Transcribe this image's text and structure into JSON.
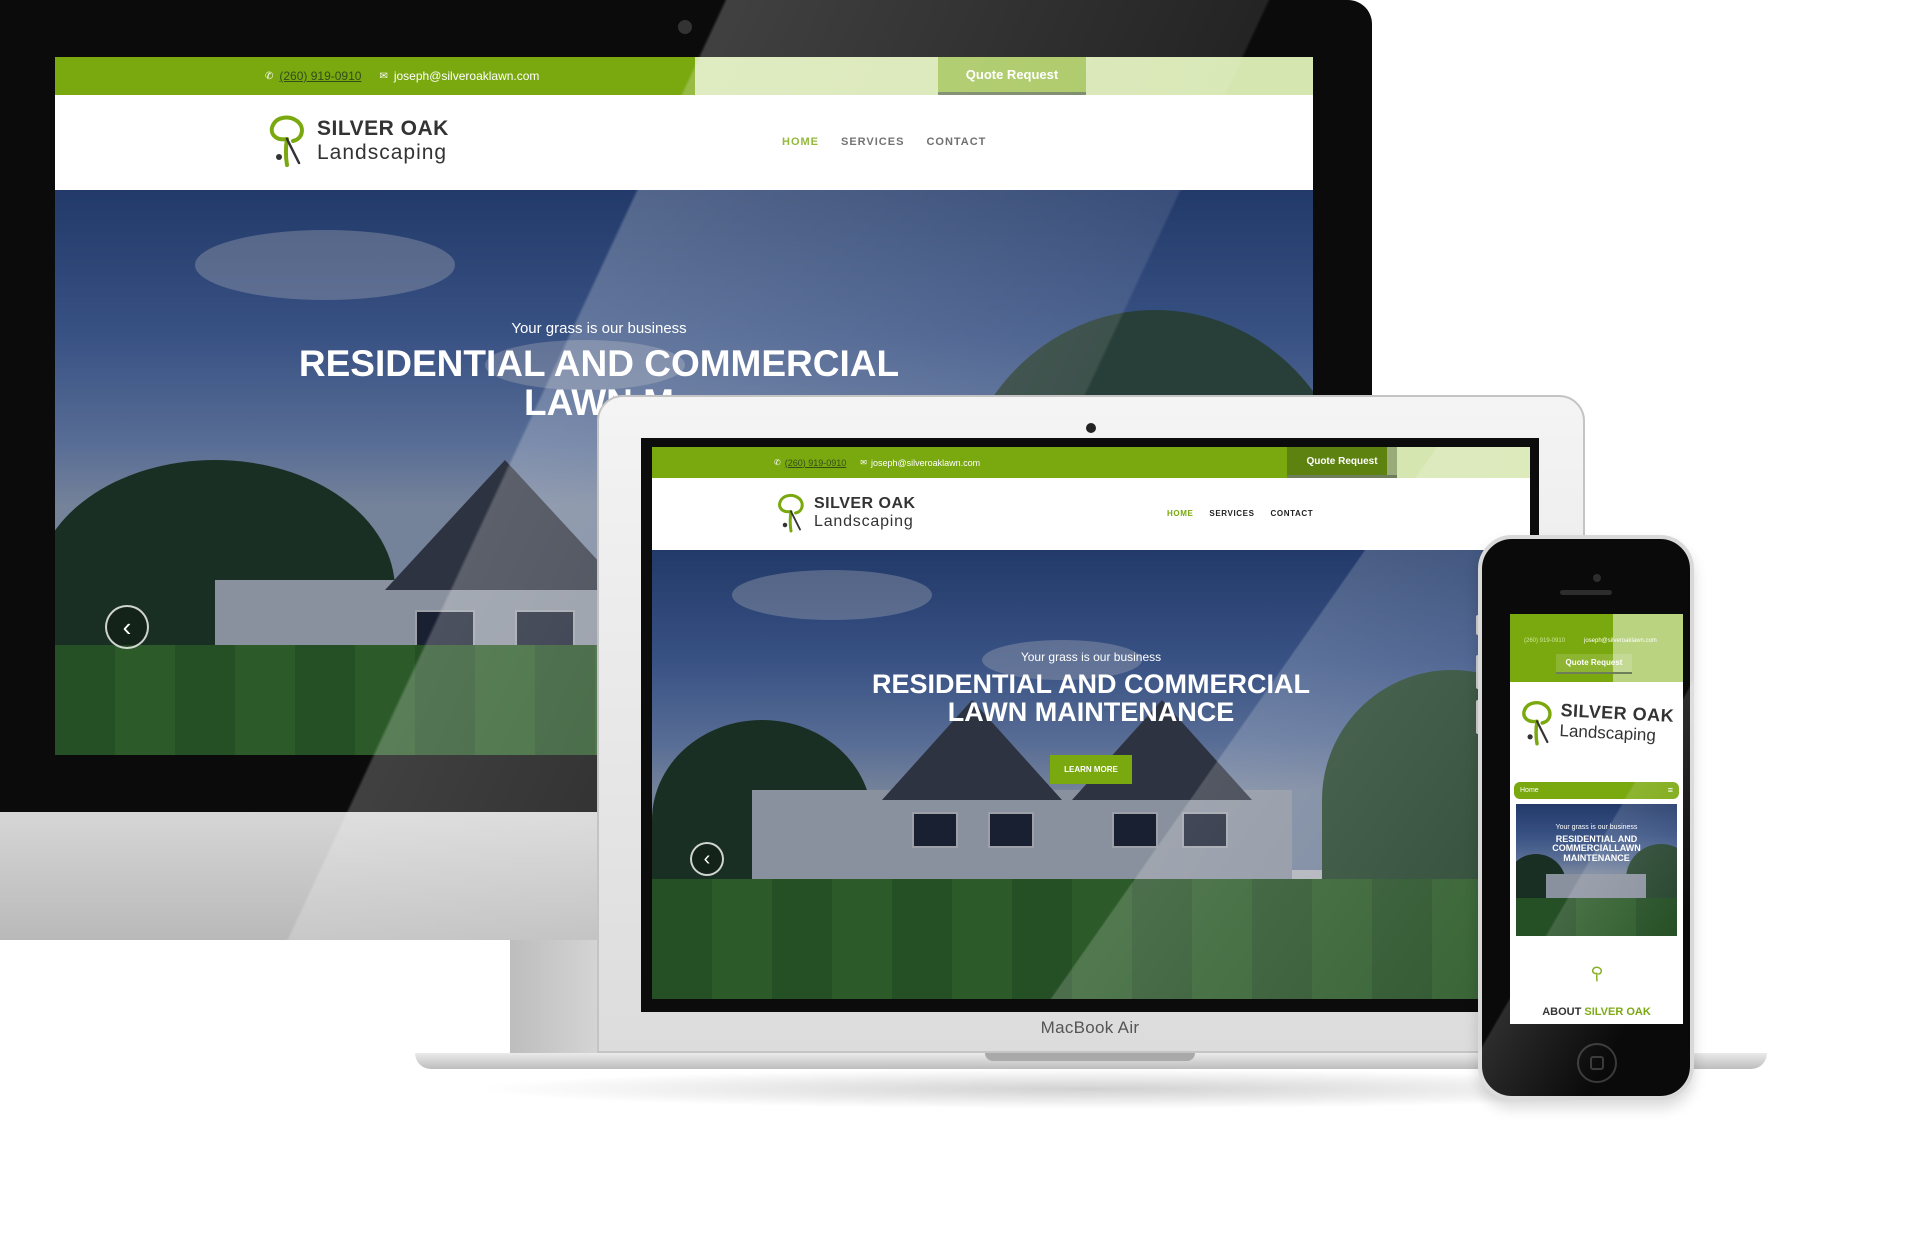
{
  "site": {
    "phone": "(260) 919-0910",
    "email": "joseph@silveroaklawn.com",
    "quote_label": "Quote Request",
    "brand_line1": "SILVER OAK",
    "brand_line2": "Landscaping",
    "nav": [
      "HOME",
      "SERVICES",
      "CONTACT"
    ],
    "hero_sub": "Your grass is our business",
    "hero_title_1": "RESIDENTIAL AND COMMERCIAL",
    "hero_title_2": "LAWN MAINTENANCE",
    "learn_more": "LEARN MORE",
    "accent_color": "#7aa80f"
  },
  "imac": {
    "hero_title_2_partial": "LAWN M"
  },
  "macbook": {
    "device_label": "MacBook Air"
  },
  "phone": {
    "phone_partial": "(260) 919-0910",
    "email_partial": "joseph@silveroaklawn.com",
    "menu_label": "Home",
    "burger_icon": "≡",
    "hero_sub": "Your grass is our business",
    "hero_title_1": "RESIDENTIAL AND",
    "hero_title_2": "COMMERCIALLAWN",
    "hero_title_3": "MAINTENANCE",
    "about_prefix": "ABOUT",
    "about_highlight": "SILVER OAK"
  },
  "icons": {
    "phone_icon": "✆",
    "email_icon": "✉",
    "arrow_left": "‹"
  }
}
